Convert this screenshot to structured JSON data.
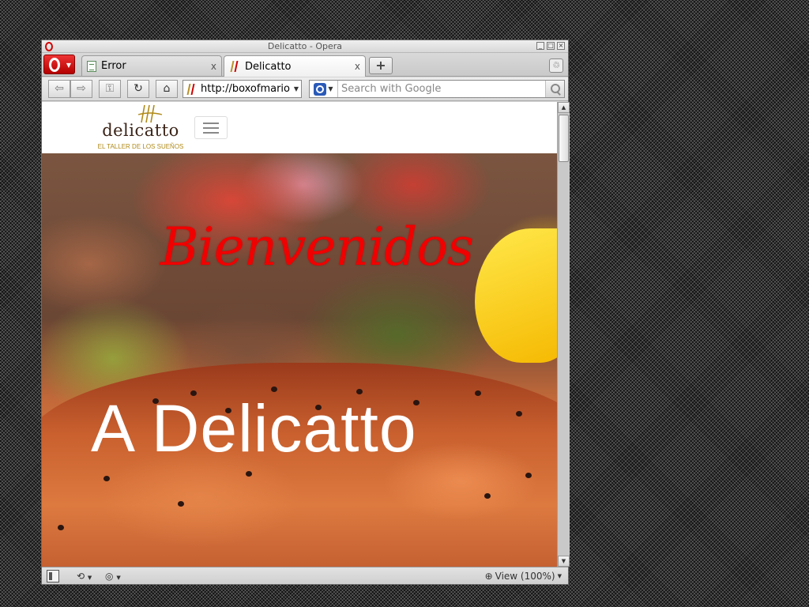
{
  "window": {
    "title": "Delicatto - Opera"
  },
  "tabs": [
    {
      "label": "Error",
      "close": "x",
      "active": false
    },
    {
      "label": "Delicatto",
      "close": "x",
      "active": true
    }
  ],
  "new_tab_label": "+",
  "toolbar": {
    "url": "http://boxofmario",
    "search_placeholder": "Search with Google"
  },
  "site": {
    "logo_text": "delicatto",
    "logo_tagline": "EL TALLER DE LOS SUEÑOS",
    "hero_title": "Bienvenidos",
    "hero_subtitle": "A Delicatto"
  },
  "statusbar": {
    "zoom_label": "View (100%)"
  },
  "colors": {
    "hero_title": "#f00000",
    "hero_subtitle": "#ffffff",
    "logo_text": "#3b2418",
    "logo_tagline": "#b08a18",
    "opera_red": "#cc0000"
  },
  "icons": [
    "opera-logo-icon",
    "page-icon",
    "site-favicon-icon",
    "close-icon",
    "plus-icon",
    "trash-icon",
    "back-icon",
    "forward-icon",
    "key-icon",
    "reload-icon",
    "home-icon",
    "search-engine-icon",
    "magnifier-icon",
    "chevron-down-icon",
    "panel-icon",
    "sync-icon",
    "turbo-icon",
    "zoom-icon"
  ]
}
